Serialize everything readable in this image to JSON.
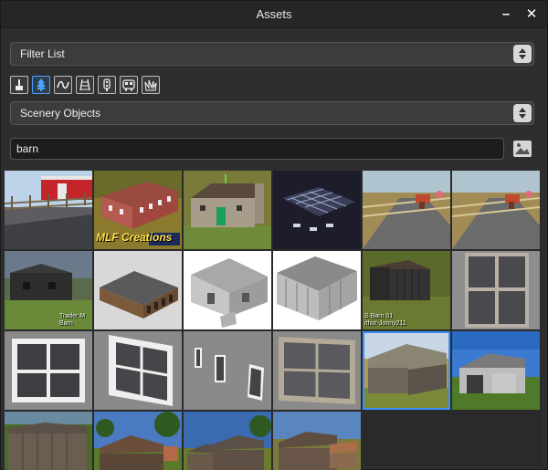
{
  "window": {
    "title": "Assets",
    "minimize_glyph": "–",
    "close_glyph": "✕"
  },
  "filter_list": {
    "value": "Filter List"
  },
  "category": {
    "value": "Scenery Objects"
  },
  "toolbar": {
    "icons": [
      "paintbrush-icon",
      "tree-icon",
      "curve-icon",
      "track-icon",
      "signal-icon",
      "vehicle-icon",
      "grass-icon"
    ],
    "active_index": 1,
    "accent_color": "#4aa3ff"
  },
  "search": {
    "value": "barn"
  },
  "assets": {
    "tiles": [
      {
        "name": "barn-red-fence"
      },
      {
        "name": "barn-brick-mlf",
        "label": "MLF Creations"
      },
      {
        "name": "barn-stone-green-door"
      },
      {
        "name": "barn-dark-wireframe"
      },
      {
        "name": "barn-road-horses-1"
      },
      {
        "name": "barn-road-horses-2"
      },
      {
        "name": "barn-trader",
        "label_lines": [
          "Trader M",
          "Barn"
        ]
      },
      {
        "name": "barn-long-shed"
      },
      {
        "name": "barn-white-plank"
      },
      {
        "name": "barn-white-plank-2"
      },
      {
        "name": "barn-dark-jonny",
        "label_lines": [
          "S Barn 01",
          "ithor-Jonny211"
        ]
      },
      {
        "name": "window-large-frame"
      },
      {
        "name": "window-white-1"
      },
      {
        "name": "window-white-2"
      },
      {
        "name": "window-small-set"
      },
      {
        "name": "window-wide-frame"
      },
      {
        "name": "barn-wood-field",
        "selected": true
      },
      {
        "name": "barn-white-sky"
      },
      {
        "name": "barn-old-wood-1"
      },
      {
        "name": "barn-old-wood-2"
      },
      {
        "name": "barn-old-wood-3"
      },
      {
        "name": "barn-old-wood-4"
      }
    ]
  }
}
